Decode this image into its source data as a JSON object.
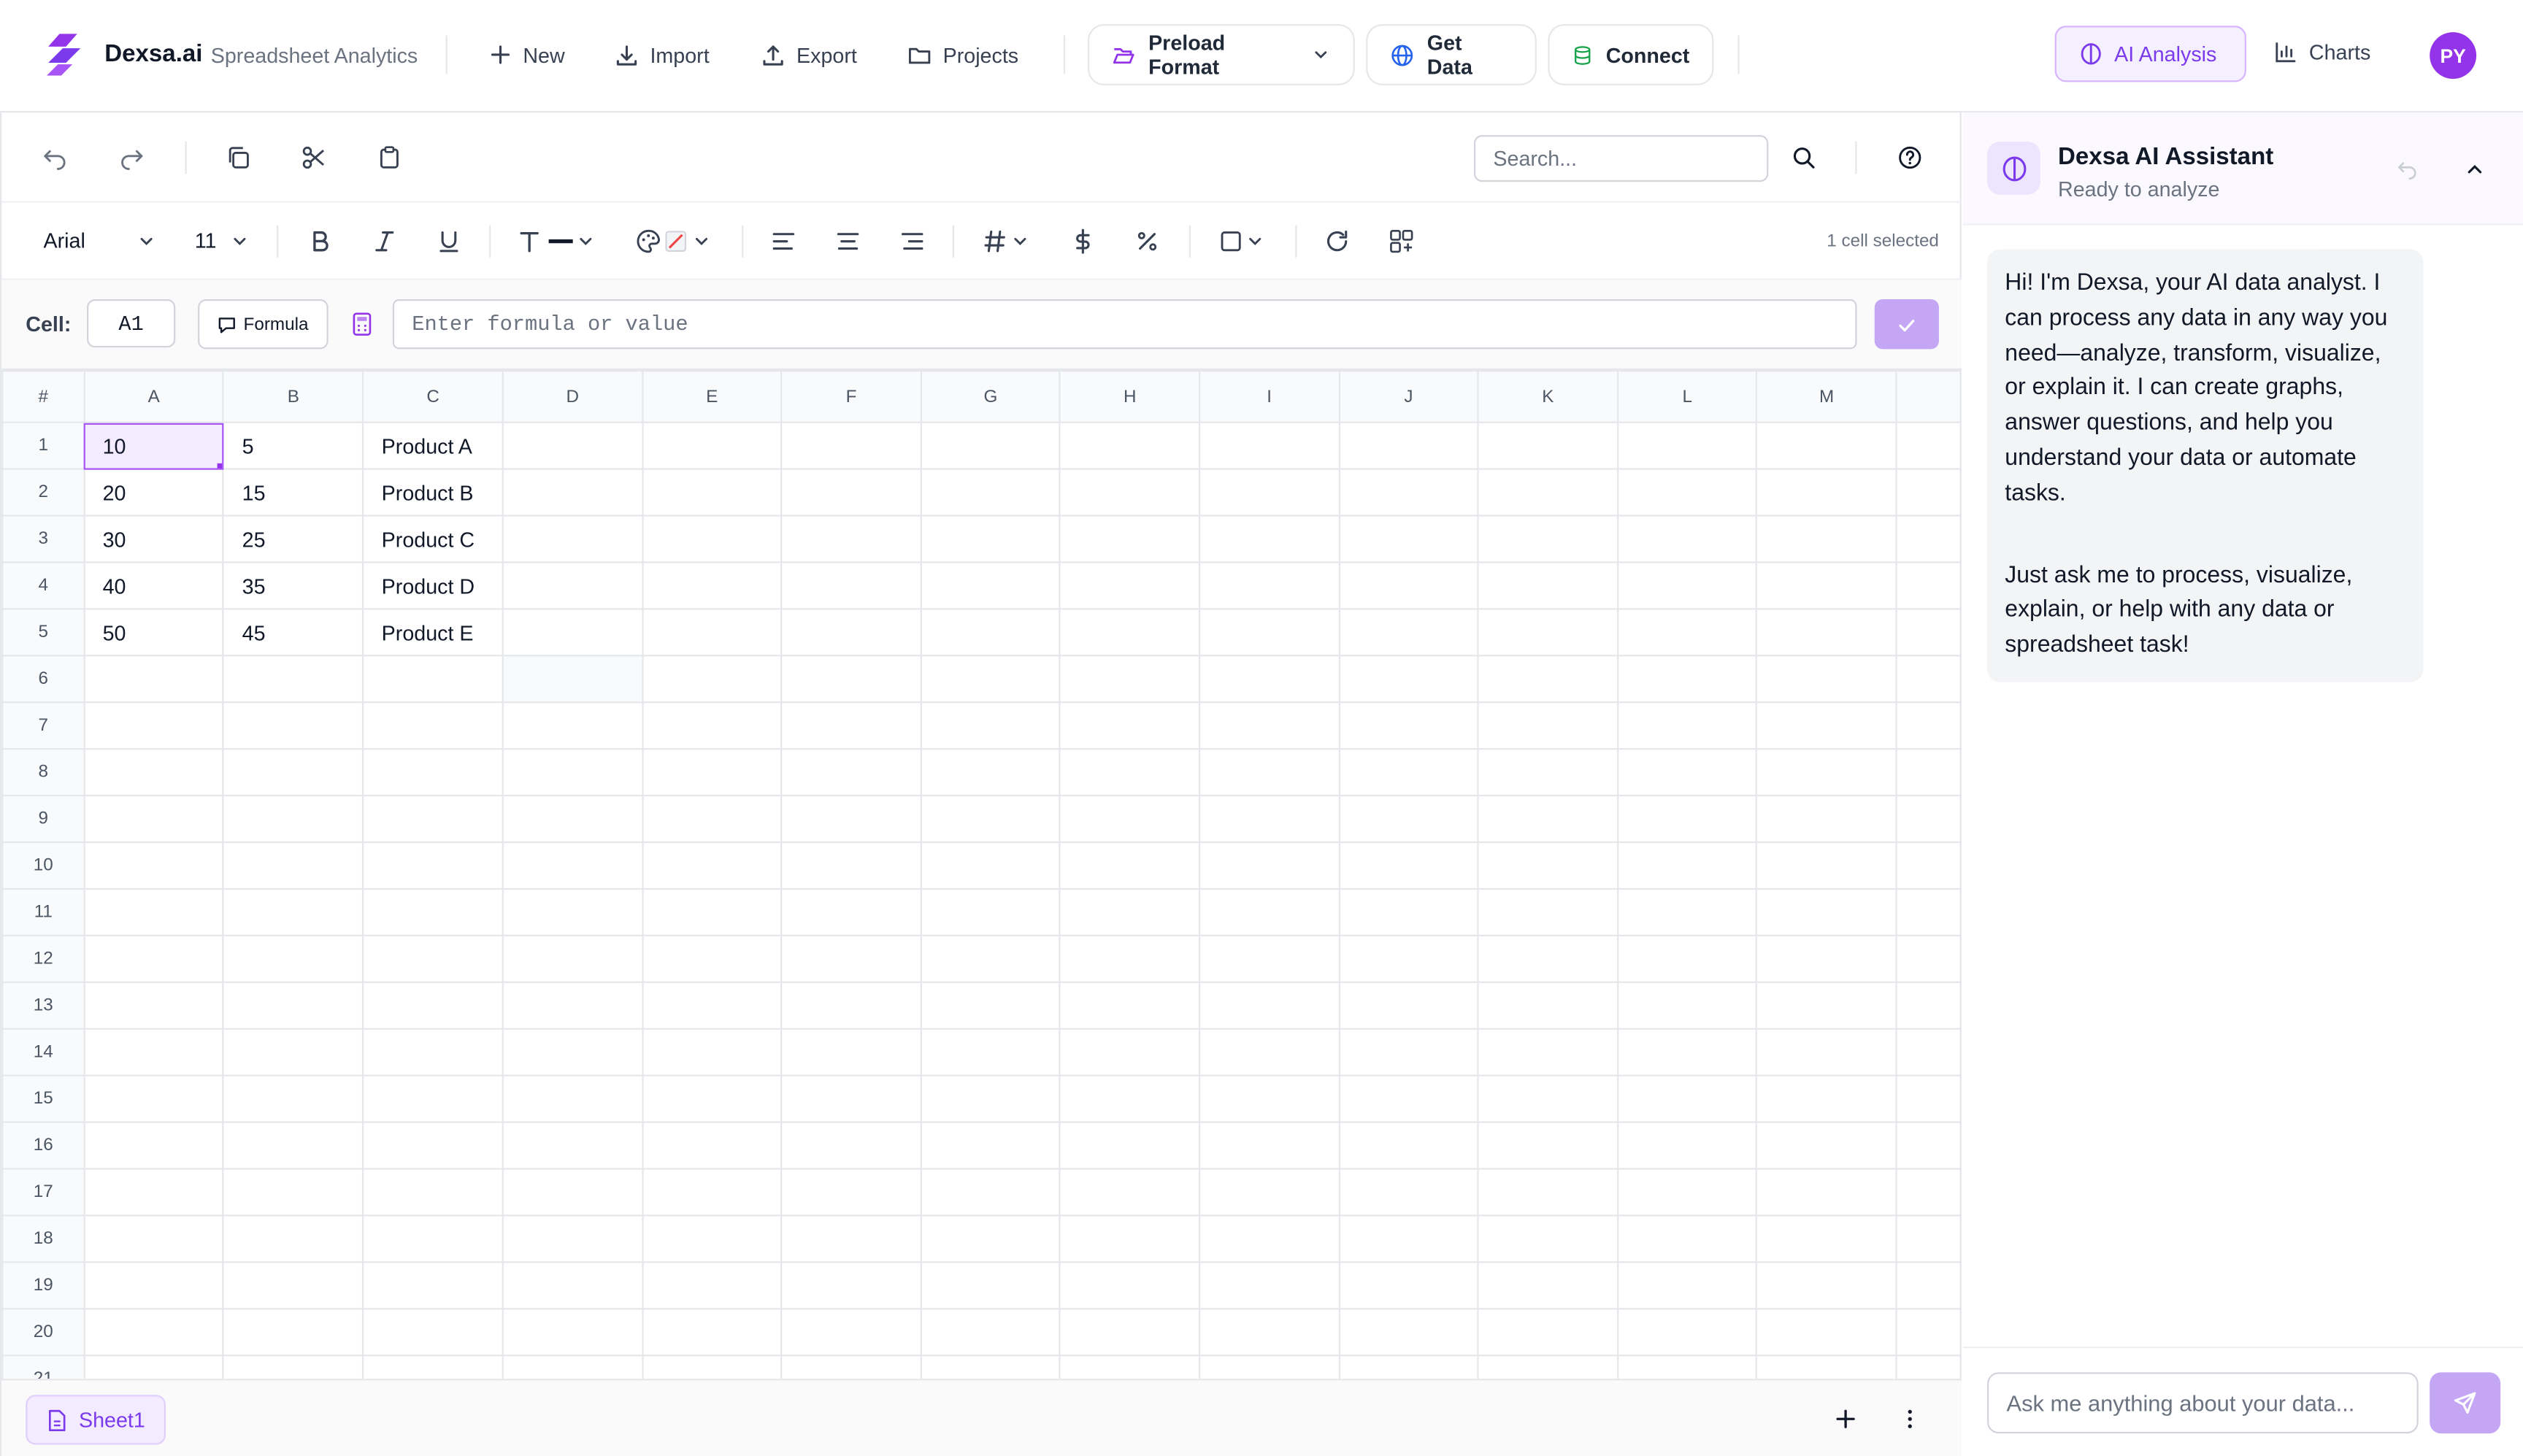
{
  "header": {
    "brand": "Dexsa.ai",
    "brand_sub": "Spreadsheet Analytics",
    "buttons": {
      "new": "New",
      "import": "Import",
      "export": "Export",
      "projects": "Projects"
    },
    "preload": "Preload Format",
    "get_data": "Get Data",
    "connect": "Connect",
    "ai_analysis": "AI Analysis",
    "charts": "Charts",
    "avatar": "PY",
    "accent": "#7c3aed"
  },
  "toolbar": {
    "search_placeholder": "Search...",
    "font": "Arial",
    "font_size": "11",
    "selection_status": "1 cell selected"
  },
  "formula": {
    "cell_label": "Cell:",
    "cell_ref": "A1",
    "formula_button": "Formula",
    "input_placeholder": "Enter formula or value"
  },
  "grid": {
    "corner": "#",
    "columns": [
      "A",
      "B",
      "C",
      "D",
      "E",
      "F",
      "G",
      "H",
      "I",
      "J",
      "K",
      "L",
      "M"
    ],
    "row_count": 21,
    "rows": [
      [
        "10",
        "5",
        "Product A"
      ],
      [
        "20",
        "15",
        "Product B"
      ],
      [
        "30",
        "25",
        "Product C"
      ],
      [
        "40",
        "35",
        "Product D"
      ],
      [
        "50",
        "45",
        "Product E"
      ]
    ]
  },
  "sheets": {
    "active": "Sheet1"
  },
  "assistant": {
    "title": "Dexsa AI Assistant",
    "status": "Ready to analyze",
    "message_p1": "Hi! I'm Dexsa, your AI data analyst. I can process any data in any way you need—analyze, transform, visualize, or explain it. I can create graphs, answer questions, and help you understand your data or automate tasks.",
    "message_p2": "Just ask me to process, visualize, explain, or help with any data or spreadsheet task!",
    "input_placeholder": "Ask me anything about your data..."
  }
}
